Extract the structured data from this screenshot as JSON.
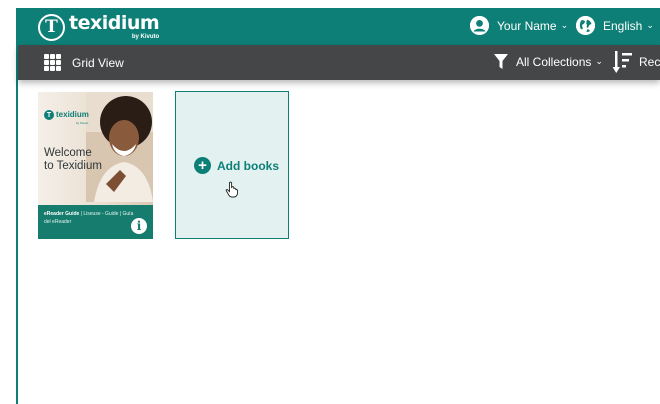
{
  "brand": {
    "name": "texidium",
    "byline": "by Kivuto",
    "monogram": "T"
  },
  "user": {
    "name": "Your Name"
  },
  "language": {
    "label": "English"
  },
  "toolbar": {
    "view_label": "Grid View",
    "collections_label": "All Collections",
    "sort_label": "Rec"
  },
  "books": [
    {
      "logo_word": "texidium",
      "logo_by": "by Kivuto",
      "logo_mark": "T",
      "title": "Welcome to Texidium",
      "subtitle_bold": "eReader Guide",
      "subtitle_rest": " | Liseuse - Guide | Guía del eReader"
    }
  ],
  "add_books": {
    "label": "Add books"
  },
  "colors": {
    "brand_teal": "#0e7f76",
    "toolbar": "#444648",
    "add_tile_bg": "#e3f2f1"
  },
  "icons": [
    "user-icon",
    "globe-icon",
    "grid-icon",
    "filter-icon",
    "sort-icon",
    "info-icon",
    "plus-icon",
    "hand-cursor-icon"
  ]
}
